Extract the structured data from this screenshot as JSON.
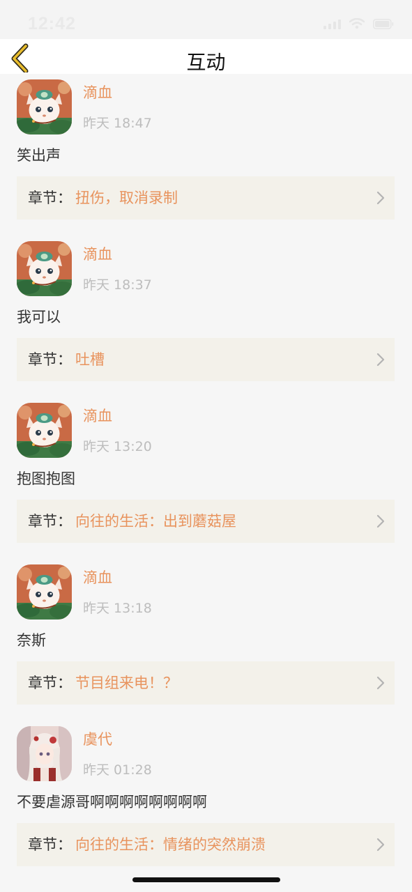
{
  "status_bar": {
    "time": "12:42"
  },
  "nav": {
    "title": "互动",
    "back_icon": "chevron-left-icon"
  },
  "colors": {
    "accent": "#e8935d",
    "card_bg": "#f3f1ea",
    "page_bg": "#f6f6f6"
  },
  "items": [
    {
      "username": "滴血",
      "time": "昨天 18:47",
      "comment": "笑出声",
      "chapter_label": "章节：",
      "chapter_title": "扭伤，取消录制",
      "avatar": "fox-avatar"
    },
    {
      "username": "滴血",
      "time": "昨天 18:37",
      "comment": "我可以",
      "chapter_label": "章节：",
      "chapter_title": "吐槽",
      "avatar": "fox-avatar"
    },
    {
      "username": "滴血",
      "time": "昨天 13:20",
      "comment": "抱图抱图",
      "chapter_label": "章节：",
      "chapter_title": "向往的生活：出到蘑菇屋",
      "avatar": "fox-avatar"
    },
    {
      "username": "滴血",
      "time": "昨天 13:18",
      "comment": "奈斯",
      "chapter_label": "章节：",
      "chapter_title": "节目组来电！？",
      "avatar": "fox-avatar"
    },
    {
      "username": "虞代",
      "time": "昨天 01:28",
      "comment": "不要虐源哥啊啊啊啊啊啊啊啊",
      "chapter_label": "章节：",
      "chapter_title": "向往的生活：情绪的突然崩溃",
      "avatar": "anime-girl-avatar"
    }
  ]
}
